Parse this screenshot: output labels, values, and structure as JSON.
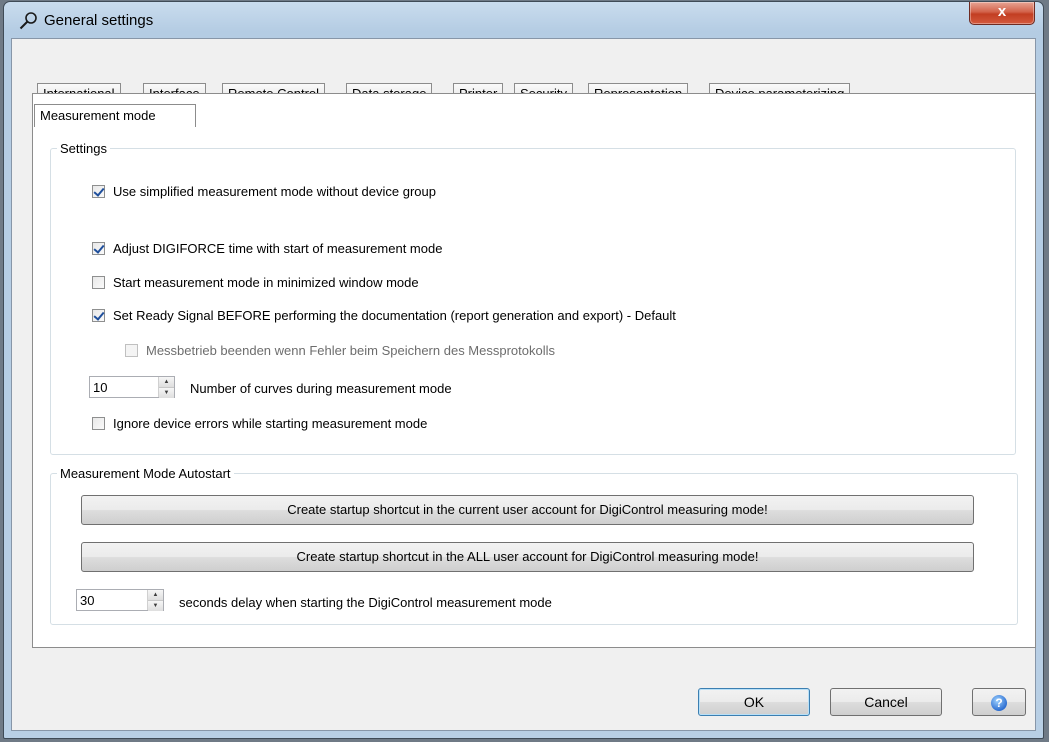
{
  "window": {
    "title": "General settings",
    "close_label": "x"
  },
  "tabs": [
    {
      "label": "International"
    },
    {
      "label": "Interface"
    },
    {
      "label": "Remote Control"
    },
    {
      "label": "Data storage"
    },
    {
      "label": "Printer"
    },
    {
      "label": "Security"
    },
    {
      "label": "Representation"
    },
    {
      "label": "Device parameterizing"
    },
    {
      "label": "Measurement mode",
      "active": true
    }
  ],
  "settings_group": {
    "title": "Settings",
    "options": [
      {
        "label": "Use simplified measurement mode without device group",
        "checked": true
      },
      {
        "label": "Adjust DIGIFORCE time with start of measurement mode",
        "checked": true
      },
      {
        "label": "Start measurement mode in minimized window mode",
        "checked": false
      },
      {
        "label": "Set Ready Signal BEFORE performing the documentation (report generation and export) - Default",
        "checked": true
      },
      {
        "label": "Messbetrieb beenden wenn Fehler beim Speichern des Messprotokolls",
        "checked": false,
        "disabled": true
      },
      {
        "label": "Ignore device errors while starting measurement mode",
        "checked": false
      }
    ],
    "curves_value": "10",
    "curves_label": "Number of curves during measurement mode"
  },
  "autostart_group": {
    "title": "Measurement Mode Autostart",
    "current_user_button": "Create startup shortcut in the current user account for DigiControl measuring mode!",
    "all_user_button": "Create startup shortcut in the ALL user account for DigiControl measuring mode!",
    "delay_value": "30",
    "delay_label": "seconds delay when starting the  DigiControl measurement mode"
  },
  "footer": {
    "ok_label": "OK",
    "cancel_label": "Cancel",
    "help_icon": "help-icon"
  },
  "colors": {
    "title_bar": "#b8cfe5",
    "close_button": "#c23e22",
    "checkbox_check": "#1f4f9c"
  }
}
